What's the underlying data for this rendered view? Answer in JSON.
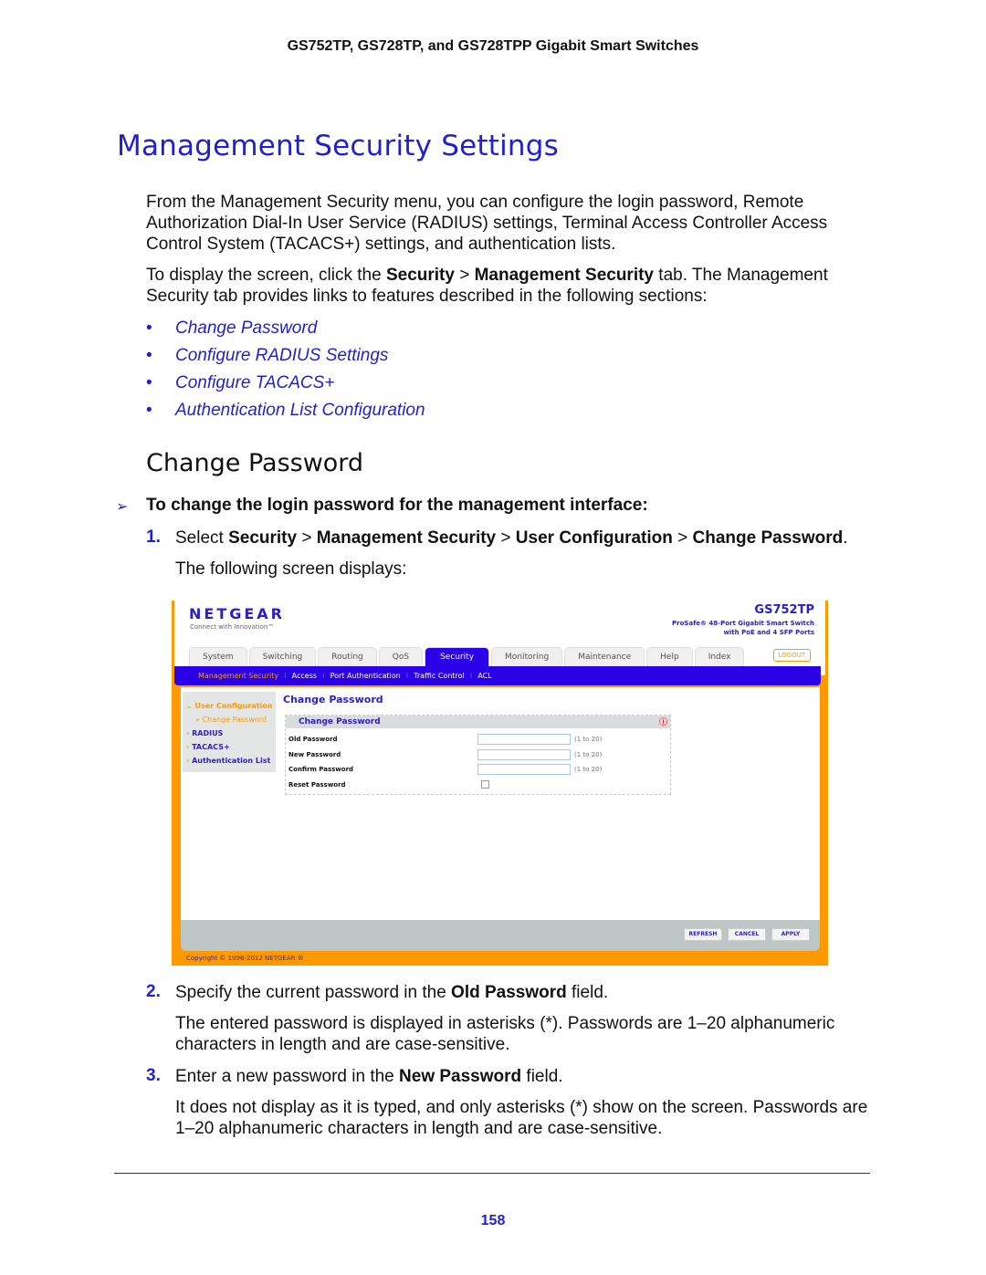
{
  "header": "GS752TP, GS728TP, and GS728TPP Gigabit Smart Switches",
  "title": "Management Security Settings",
  "intro": "From the Management Security menu, you can configure the login password, Remote Authorization Dial-In User Service (RADIUS) settings, Terminal Access Controller Access Control System (TACACS+) settings, and authentication lists.",
  "display": {
    "a": "To display the screen, click the ",
    "b": "Security",
    "c": " > ",
    "d": "Management Security",
    "e": " tab. The Management Security tab provides links to features described in the following sections:"
  },
  "links": [
    "Change Password",
    "Configure RADIUS Settings",
    "Configure TACACS+",
    "Authentication List Configuration"
  ],
  "section": "Change Password",
  "procedure": "To change the login password for the management interface:",
  "steps": [
    {
      "num": "1.",
      "parts": [
        "Select ",
        "Security",
        " > ",
        "Management Security",
        " > ",
        "User Configuration",
        " > ",
        "Change Password",
        "."
      ],
      "note": "The following screen displays:"
    },
    {
      "num": "2.",
      "parts": [
        "Specify the current password in the ",
        "Old Password",
        " field."
      ],
      "note": "The entered password is displayed in asterisks (*). Passwords are 1–20 alphanumeric characters in length and are case-sensitive."
    },
    {
      "num": "3.",
      "parts": [
        "Enter a new password in the ",
        "New Password",
        " field."
      ],
      "note": "It does not display as it is typed, and only asterisks (*) show on the screen. Passwords are 1–20 alphanumeric characters in length and are case-sensitive."
    }
  ],
  "screenshot": {
    "logo": "NETGEAR",
    "tagline": "Connect with Innovation™",
    "model": "GS752TP",
    "desc1": "ProSafe® 48-Port Gigabit Smart Switch",
    "desc2": "with PoE and 4 SFP Ports",
    "tabs": [
      "System",
      "Switching",
      "Routing",
      "QoS",
      "Security",
      "Monitoring",
      "Maintenance",
      "Help",
      "Index"
    ],
    "logout": "LOGOUT",
    "subtabs": [
      "Management Security",
      "Access",
      "Port Authentication",
      "Traffic Control",
      "ACL"
    ],
    "sidebar": [
      "User Configuration",
      "Change Password",
      "RADIUS",
      "TACACS+",
      "Authentication List"
    ],
    "content_title": "Change Password",
    "panel_title": "Change Password",
    "fields": [
      {
        "label": "Old Password",
        "range": "(1 to 20)"
      },
      {
        "label": "New Password",
        "range": "(1 to 20)"
      },
      {
        "label": "Confirm Password",
        "range": "(1 to 20)"
      },
      {
        "label": "Reset Password"
      }
    ],
    "buttons": [
      "REFRESH",
      "CANCEL",
      "APPLY"
    ],
    "copyright": "Copyright © 1996-2012 NETGEAR ®",
    "colors": {
      "frame": "#ff9900",
      "nav": "#2a00e6",
      "link": "#2a1fc9"
    }
  },
  "page_number": "158"
}
